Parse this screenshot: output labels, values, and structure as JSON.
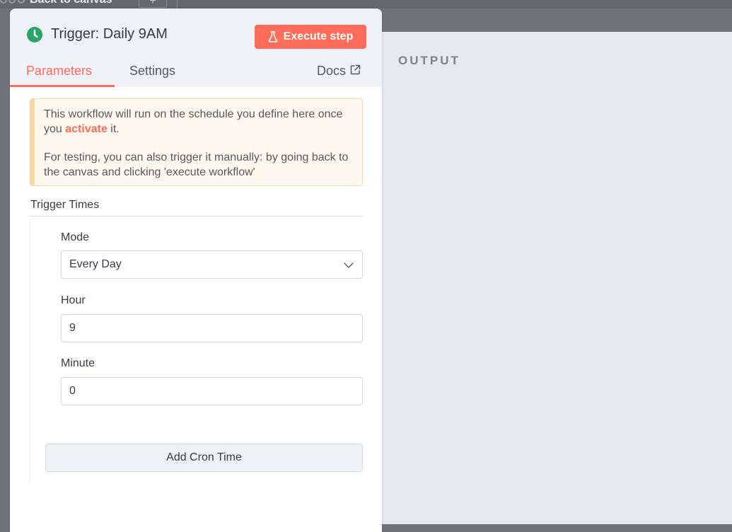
{
  "background": {
    "back_label": "Back to canvas",
    "plus_label": "+"
  },
  "output": {
    "title": "OUTPUT"
  },
  "panel": {
    "title": "Trigger: Daily 9AM",
    "trigger_icon": "clock-icon",
    "execute_label": "Execute step",
    "execute_icon": "flask-icon",
    "tabs": [
      {
        "label": "Parameters",
        "active": true
      },
      {
        "label": "Settings",
        "active": false
      }
    ],
    "docs_label": "Docs",
    "docs_icon": "external-link-icon"
  },
  "notice": {
    "line1_before": "This workflow will run on the schedule you define here once you ",
    "activate_link": "activate",
    "line1_after": " it.",
    "line2": "For testing, you can also trigger it manually: by going back to the canvas and clicking 'execute workflow'"
  },
  "trigger_times": {
    "section_label": "Trigger Times",
    "mode_label": "Mode",
    "mode_value": "Every Day",
    "hour_label": "Hour",
    "hour_value": "9",
    "minute_label": "Minute",
    "minute_value": "0",
    "add_button_label": "Add Cron Time"
  },
  "colors": {
    "accent": "#ff6d5a",
    "success": "#29a568",
    "notice_bg": "#fff8ee",
    "notice_border": "#f8d7a3",
    "output_bg": "#e6e9f2"
  }
}
